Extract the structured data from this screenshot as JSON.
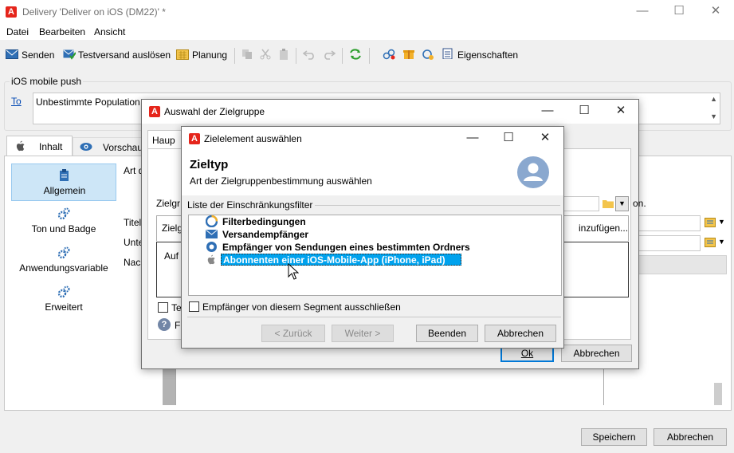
{
  "window": {
    "title": "Delivery 'Deliver on iOS (DM22)' *",
    "menu": [
      "Datei",
      "Bearbeiten",
      "Ansicht"
    ],
    "toolbar": {
      "send": "Senden",
      "proof": "Testversand auslösen",
      "schedule": "Planung",
      "properties": "Eigenschaften"
    },
    "group_title": "iOS mobile push",
    "to_label": "To",
    "to_value": "Unbestimmte Population",
    "tabs": {
      "content": "Inhalt",
      "preview": "Vorschau"
    },
    "sidebar": [
      "Allgemein",
      "Ton und Badge",
      "Anwendungsvariable",
      "Erweitert"
    ],
    "form_labels": {
      "type": "Art d",
      "title": "Titel",
      "subtitle": "Unte",
      "message": "Nach"
    },
    "save": "Speichern",
    "cancel": "Abbrechen"
  },
  "dialog1": {
    "title": "Auswahl der Zielgruppe",
    "tab": "Haup",
    "target_label": "Zielgr",
    "target_col": "Zielgr",
    "target_area": "Auf",
    "add_link": "inzufügen...",
    "suffix": "on.",
    "test_label": "Te",
    "help_label": "F",
    "ok": "Ok",
    "cancel": "Abbrechen"
  },
  "dialog2": {
    "title": "Zielelement auswählen",
    "heading": "Zieltyp",
    "subheading": "Art der Zielgruppenbestimmung auswählen",
    "list_label": "Liste der Einschränkungsfilter",
    "items": [
      "Filterbedingungen",
      "Versandempfänger",
      "Empfänger von Sendungen eines bestimmten Ordners",
      "Abonnenten einer iOS-Mobile-App (iPhone, iPad)"
    ],
    "exclude_label": "Empfänger von diesem Segment ausschließen",
    "back": "< Zurück",
    "next": "Weiter >",
    "finish": "Beenden",
    "cancel": "Abbrechen"
  },
  "colors": {
    "accent": "#0078d7",
    "selection": "#00a2ed",
    "adobe": "#e5251b"
  }
}
